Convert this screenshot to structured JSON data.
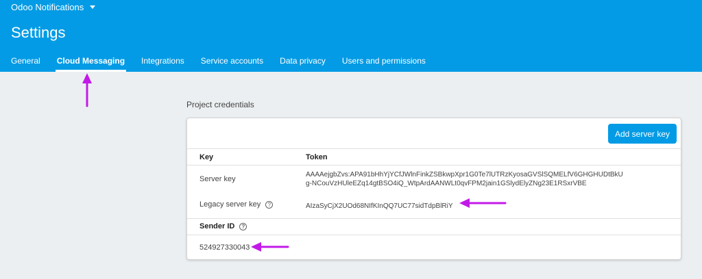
{
  "header": {
    "project_name": "Odoo Notifications",
    "title": "Settings",
    "tabs": [
      {
        "label": "General"
      },
      {
        "label": "Cloud Messaging"
      },
      {
        "label": "Integrations"
      },
      {
        "label": "Service accounts"
      },
      {
        "label": "Data privacy"
      },
      {
        "label": "Users and permissions"
      }
    ]
  },
  "section": {
    "label": "Project credentials"
  },
  "credentials": {
    "add_button": "Add server key",
    "columns": {
      "key": "Key",
      "token": "Token"
    },
    "server_key": {
      "label": "Server key",
      "token_line1": "AAAAejgbZvs:APA91bHhYjYCfJWlnFinkZSBkwpXpr1G0Te7lUTRzKyosaGVSlSQMELfV6GHGHUDtBkU",
      "token_line2": "g-NCouVzHUleEZq14gtBSO4iQ_WtpArdAANWLt0qvFPM2jain1GSlydElyZNg23E1RSxrVBE"
    },
    "legacy_server_key": {
      "label": "Legacy server key",
      "token": "AIzaSyCjX2UOd68NIfKInQQ7UC77sidTdpBlRiY"
    },
    "sender_id": {
      "label": "Sender ID",
      "value": "524927330043"
    }
  },
  "annotation_color": "#c219e8"
}
